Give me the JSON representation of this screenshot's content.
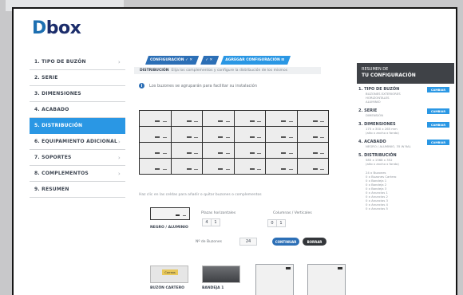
{
  "brand": {
    "logo_d": "D",
    "logo_rest": "box"
  },
  "sidebar": {
    "items": [
      {
        "label": "1. TIPO DE BUZÓN",
        "chevron": true
      },
      {
        "label": "2. SERIE",
        "chevron": false
      },
      {
        "label": "3. DIMENSIONES",
        "chevron": false
      },
      {
        "label": "4. ACABADO",
        "chevron": false
      },
      {
        "label": "5. DISTRIBUCIÓN",
        "chevron": false,
        "active": true
      },
      {
        "label": "6. EQUIPAMIENTO ADICIONAL",
        "chevron": true
      },
      {
        "label": "7. SOPORTES",
        "chevron": true
      },
      {
        "label": "8. COMPLEMENTOS",
        "chevron": true
      },
      {
        "label": "9. RESUMEN",
        "chevron": false
      }
    ]
  },
  "breadcrumbs": [
    "CONFIGURACIÓN ✓ ✕",
    "✓ ✕",
    "AGREGAR CONFIGURACIÓN ⊞"
  ],
  "step_bar": {
    "title": "DISTRIBUCIÓN",
    "text": "Elija los complementos y configure la distribución de los mismos"
  },
  "info_text": "Los buzones se agruparán para facilitar su instalación",
  "mailbox_grid": {
    "rows": 4,
    "cols": 6
  },
  "help_text": "Haz clic en las celdas para añadir o quitar buzones o complementos",
  "config": {
    "mailbox_label": "NEGRO / ALUMINIO",
    "plazas_label": "Plazas horizontales",
    "plazas_minus": "4",
    "plazas_plus": "1",
    "columnas_label": "Columnas / Verticales",
    "columnas_minus": "0",
    "columnas_plus": "1",
    "buzones_label": "Nº de Buzones",
    "buzones_value": "24",
    "continuar_label": "CONTINUAR",
    "borrar_label": "BORRAR"
  },
  "complements": [
    {
      "label": "BUZÓN CARTERO",
      "tag": "Correos"
    },
    {
      "label": "BANDEJA 1"
    }
  ],
  "summary": {
    "header_small": "RESUMEN DE",
    "header_big": "TU CONFIGURACIÓN",
    "cambiar_label": "CAMBIAR",
    "items": [
      {
        "title": "1. TIPO DE BUZÓN",
        "details": [
          "BUZONES EXTERIORES",
          "HORIZONTALES",
          "ALUMINIO"
        ],
        "has_button": true
      },
      {
        "title": "2. SERIE",
        "details": [
          "DIMENSIÓN"
        ],
        "has_button": true
      },
      {
        "title": "3. DIMENSIONES",
        "details": [
          "175 x 300 x 265 mm",
          "(alto x ancho x fondo)"
        ],
        "has_button": true
      },
      {
        "title": "4. ACABADO",
        "details": [
          "NEGRO / ALUMINIO, 35 W RAL"
        ],
        "has_button": true
      },
      {
        "title": "5. DISTRIBUCIÓN",
        "details": [
          "585 x 1568 x 352",
          "(alto x ancho x fondo)"
        ],
        "has_button": false
      }
    ],
    "extras": [
      "24 x Buzones",
      "0 x Buzones Cartero",
      "0 x Bandeja 1",
      "0 x Bandeja 2",
      "0 x Bandeja 3",
      "0 x Anuncios 1",
      "0 x Anuncios 2",
      "0 x Anuncios 3",
      "0 x Anuncios 4",
      "0 x Anuncios 5"
    ]
  }
}
